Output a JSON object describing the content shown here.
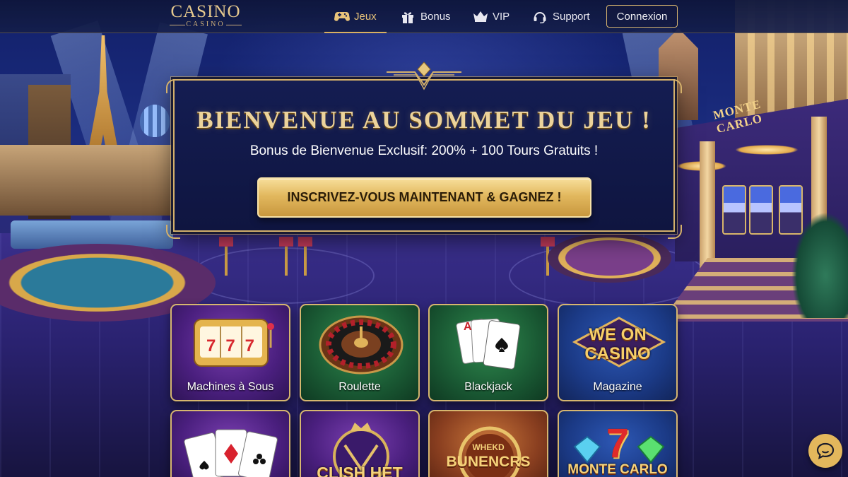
{
  "brand": {
    "name": "CASINO",
    "subname": "CASINO"
  },
  "nav": {
    "items": [
      {
        "label": "Jeux",
        "icon": "gamepad-icon",
        "active": true
      },
      {
        "label": "Bonus",
        "icon": "gift-icon",
        "active": false
      },
      {
        "label": "VIP",
        "icon": "crown-icon",
        "active": false
      },
      {
        "label": "Support",
        "icon": "headset-icon",
        "active": false
      }
    ],
    "login_label": "Connexion"
  },
  "scene": {
    "sign_text": "MONTE CARLO"
  },
  "hero": {
    "title": "BIENVENUE AU SOMMET DU JEU !",
    "subtitle": "Bonus de Bienvenue Exclusif: 200% + 100 Tours Gratuits !",
    "cta_label": "INSCRIVEZ-VOUS MAINTENANT & GAGNEZ !"
  },
  "games": [
    {
      "label": "Machines à Sous",
      "art": "slot-machine-icon",
      "art_text": "777"
    },
    {
      "label": "Roulette",
      "art": "roulette-wheel-icon"
    },
    {
      "label": "Blackjack",
      "art": "playing-cards-icon",
      "art_text": "A"
    },
    {
      "label": "Magazine",
      "art": "magazine-logo-icon",
      "art_text": "WE ON CASINO"
    },
    {
      "art": "poker-cards-icon"
    },
    {
      "art": "clish-het-logo-icon",
      "art_text": "CLISH HET"
    },
    {
      "art": "bunencrs-logo-icon",
      "art_text": "BUNENCRS",
      "art_text_top": "WHEKD"
    },
    {
      "art": "monte-carlo-logo-icon",
      "art_text": "MONTE CARLO",
      "art_numeral": "7"
    }
  ],
  "colors": {
    "gold": "#d4b06a",
    "navy": "#0f1540",
    "accent": "#e3b75c"
  },
  "chat": {
    "icon": "chat-bubble-icon"
  }
}
